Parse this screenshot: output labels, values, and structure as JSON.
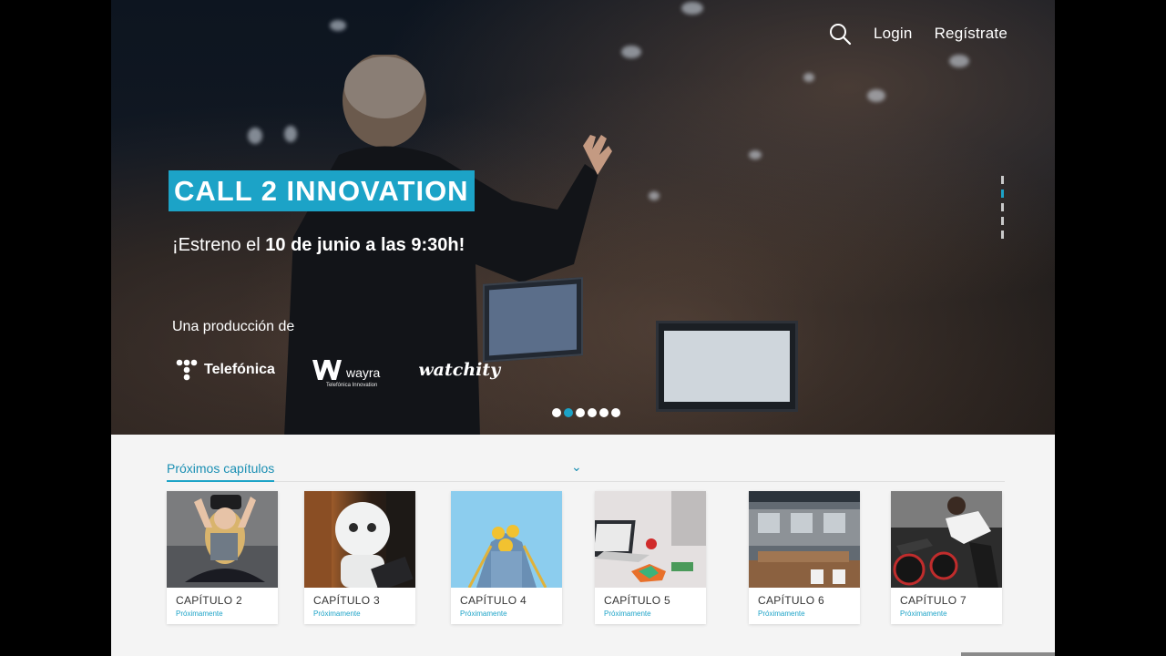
{
  "nav": {
    "login": "Login",
    "register": "Regístrate"
  },
  "hero": {
    "title": "CALL 2 INNOVATION",
    "premiere_prefix": "¡Estreno el ",
    "premiere_bold": "10 de junio a las 9:30h!",
    "production_label": "Una producción de",
    "logos": {
      "telefonica": "Telefónica",
      "wayra": "wayra",
      "wayra_sub": "Telefónica Innovation",
      "watchity": "watchity"
    },
    "slide_count": 6,
    "active_slide": 2
  },
  "section": {
    "title": "Próximos capítulos"
  },
  "chapters": [
    {
      "label": "CAPÍTULO 2",
      "status": "Próximamente"
    },
    {
      "label": "CAPÍTULO 3",
      "status": "Próximamente"
    },
    {
      "label": "CAPÍTULO 4",
      "status": "Próximamente"
    },
    {
      "label": "CAPÍTULO 5",
      "status": "Próximamente"
    },
    {
      "label": "CAPÍTULO 6",
      "status": "Próximamente"
    },
    {
      "label": "CAPÍTULO 7",
      "status": "Próximamente"
    }
  ],
  "colors": {
    "accent": "#1ca3c7",
    "section_bg": "#f4f4f4"
  }
}
